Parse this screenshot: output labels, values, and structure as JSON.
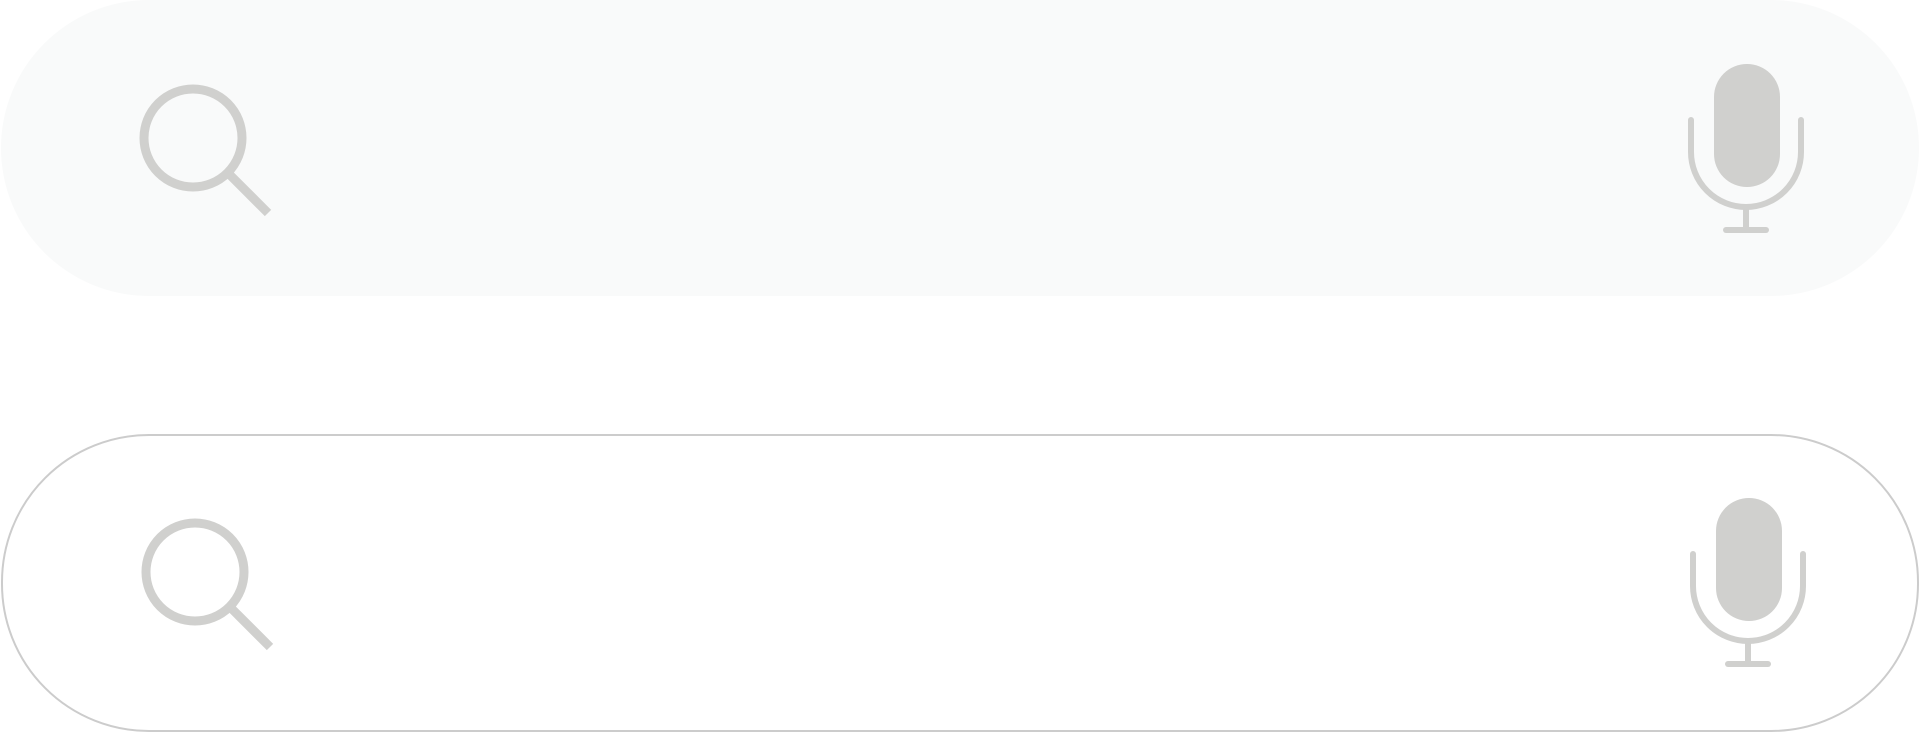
{
  "colors": {
    "filled_background": "#f9fafa",
    "outline": "#cccccc",
    "icon": "#d0d0ce"
  },
  "search_bars": [
    {
      "variant": "filled",
      "input": {
        "value": "",
        "placeholder": ""
      },
      "icons": {
        "leading": "search-icon",
        "trailing": "mic-icon"
      }
    },
    {
      "variant": "outlined",
      "input": {
        "value": "",
        "placeholder": ""
      },
      "icons": {
        "leading": "search-icon",
        "trailing": "mic-icon"
      }
    }
  ]
}
